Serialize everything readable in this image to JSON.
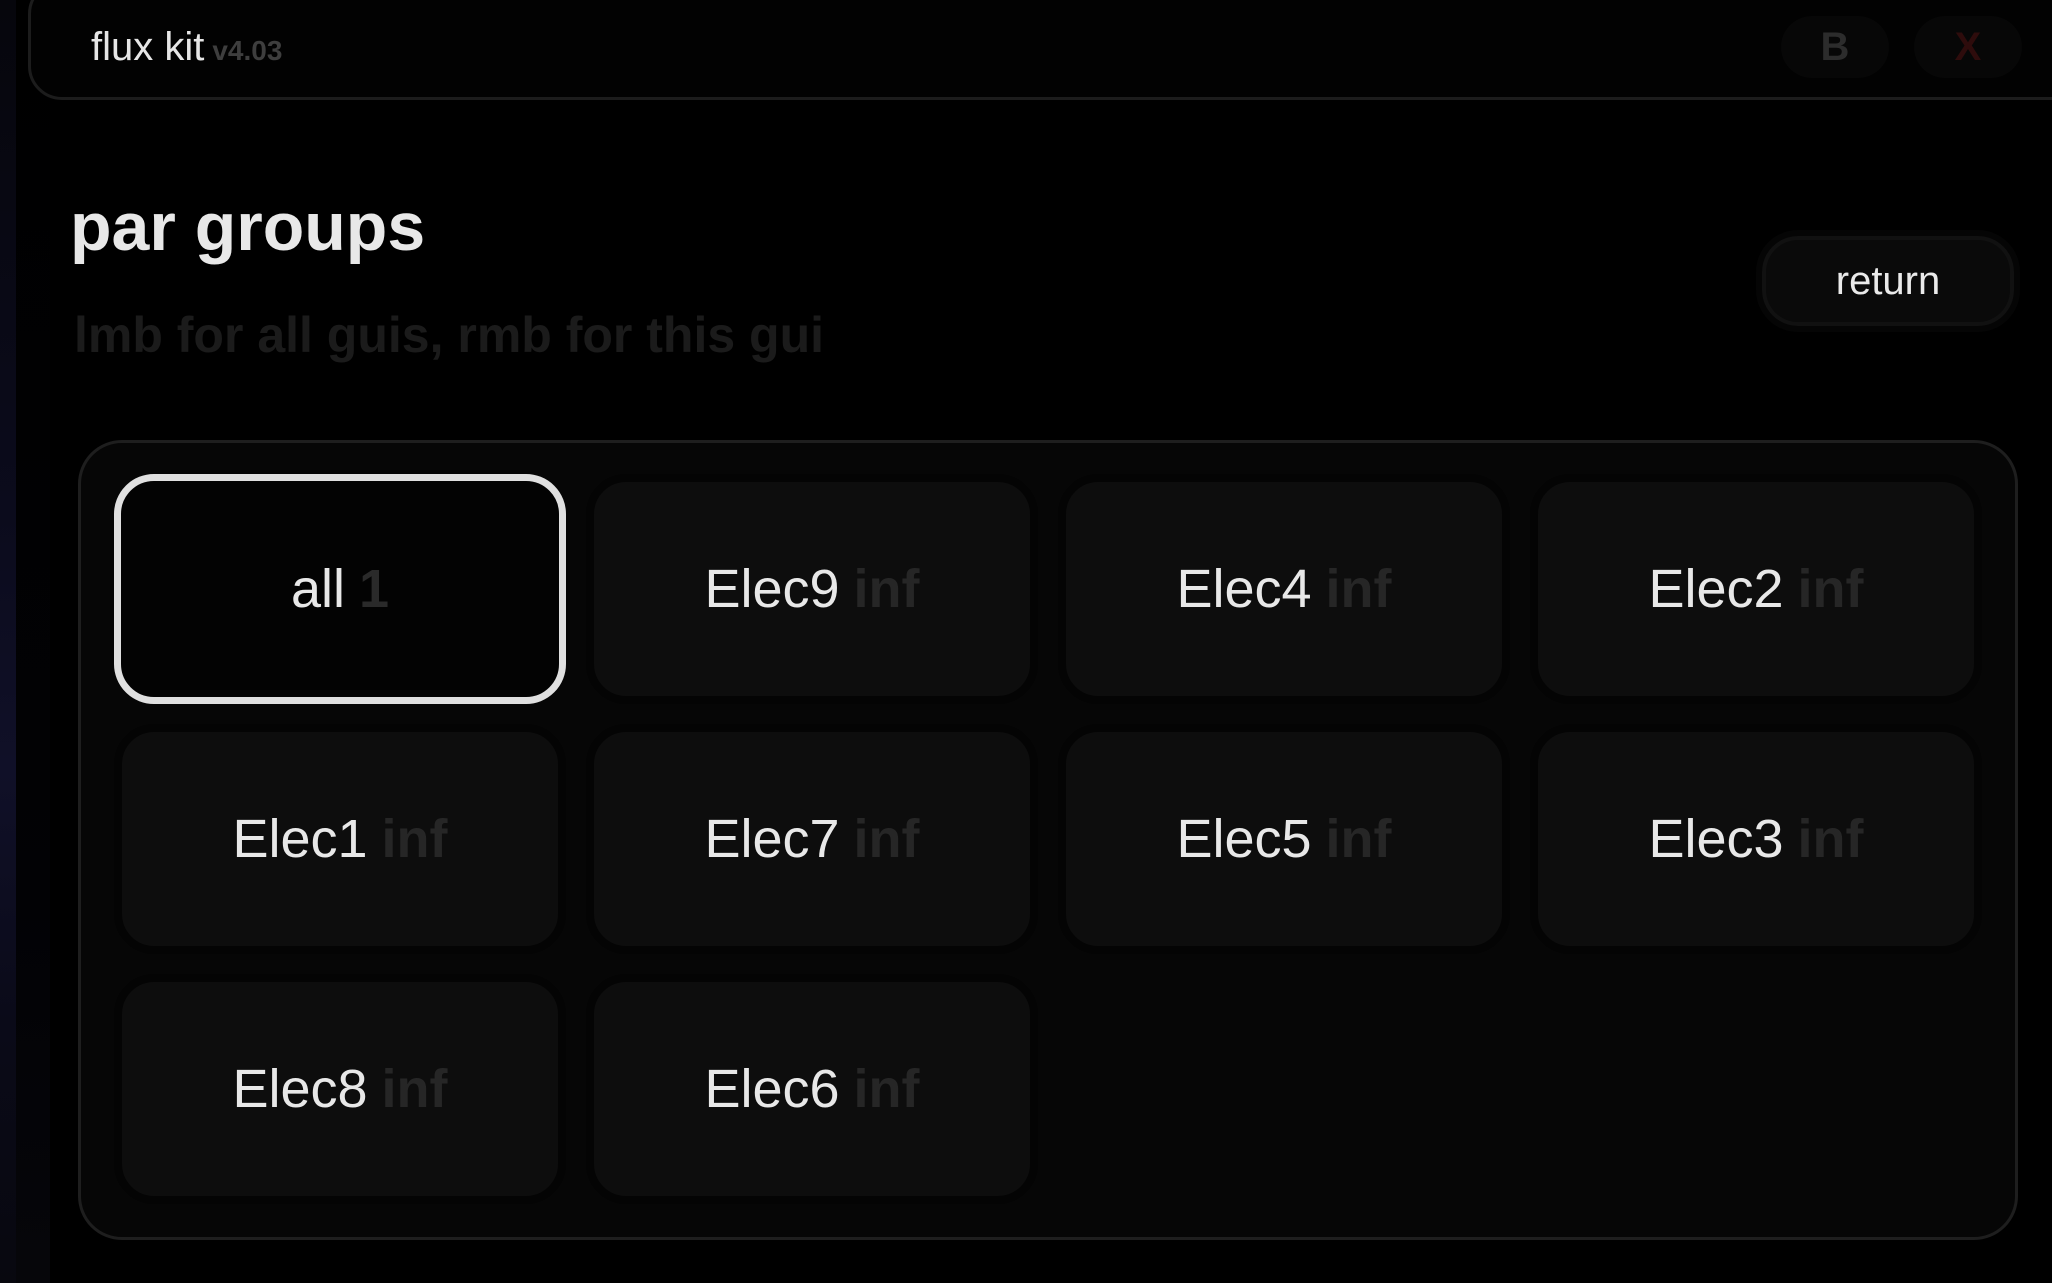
{
  "window": {
    "title": "flux kit",
    "version": "v4.03",
    "b_label": "B",
    "close_label": "X"
  },
  "header": {
    "title": "par groups",
    "subtitle": "lmb for all guis, rmb for this gui",
    "return_label": "return"
  },
  "groups": [
    {
      "name": "all",
      "value": "1",
      "selected": true
    },
    {
      "name": "Elec9",
      "value": "inf"
    },
    {
      "name": "Elec4",
      "value": "inf"
    },
    {
      "name": "Elec2",
      "value": "inf"
    },
    {
      "name": "Elec1",
      "value": "inf"
    },
    {
      "name": "Elec7",
      "value": "inf"
    },
    {
      "name": "Elec5",
      "value": "inf"
    },
    {
      "name": "Elec3",
      "value": "inf"
    },
    {
      "name": "Elec8",
      "value": "inf"
    },
    {
      "name": "Elec6",
      "value": "inf"
    }
  ],
  "colors": {
    "background": "#000000",
    "text": "#e8e8e8",
    "muted": "#262626",
    "selected_border": "#e0e0e0",
    "close_accent": "#2e0c0c"
  }
}
